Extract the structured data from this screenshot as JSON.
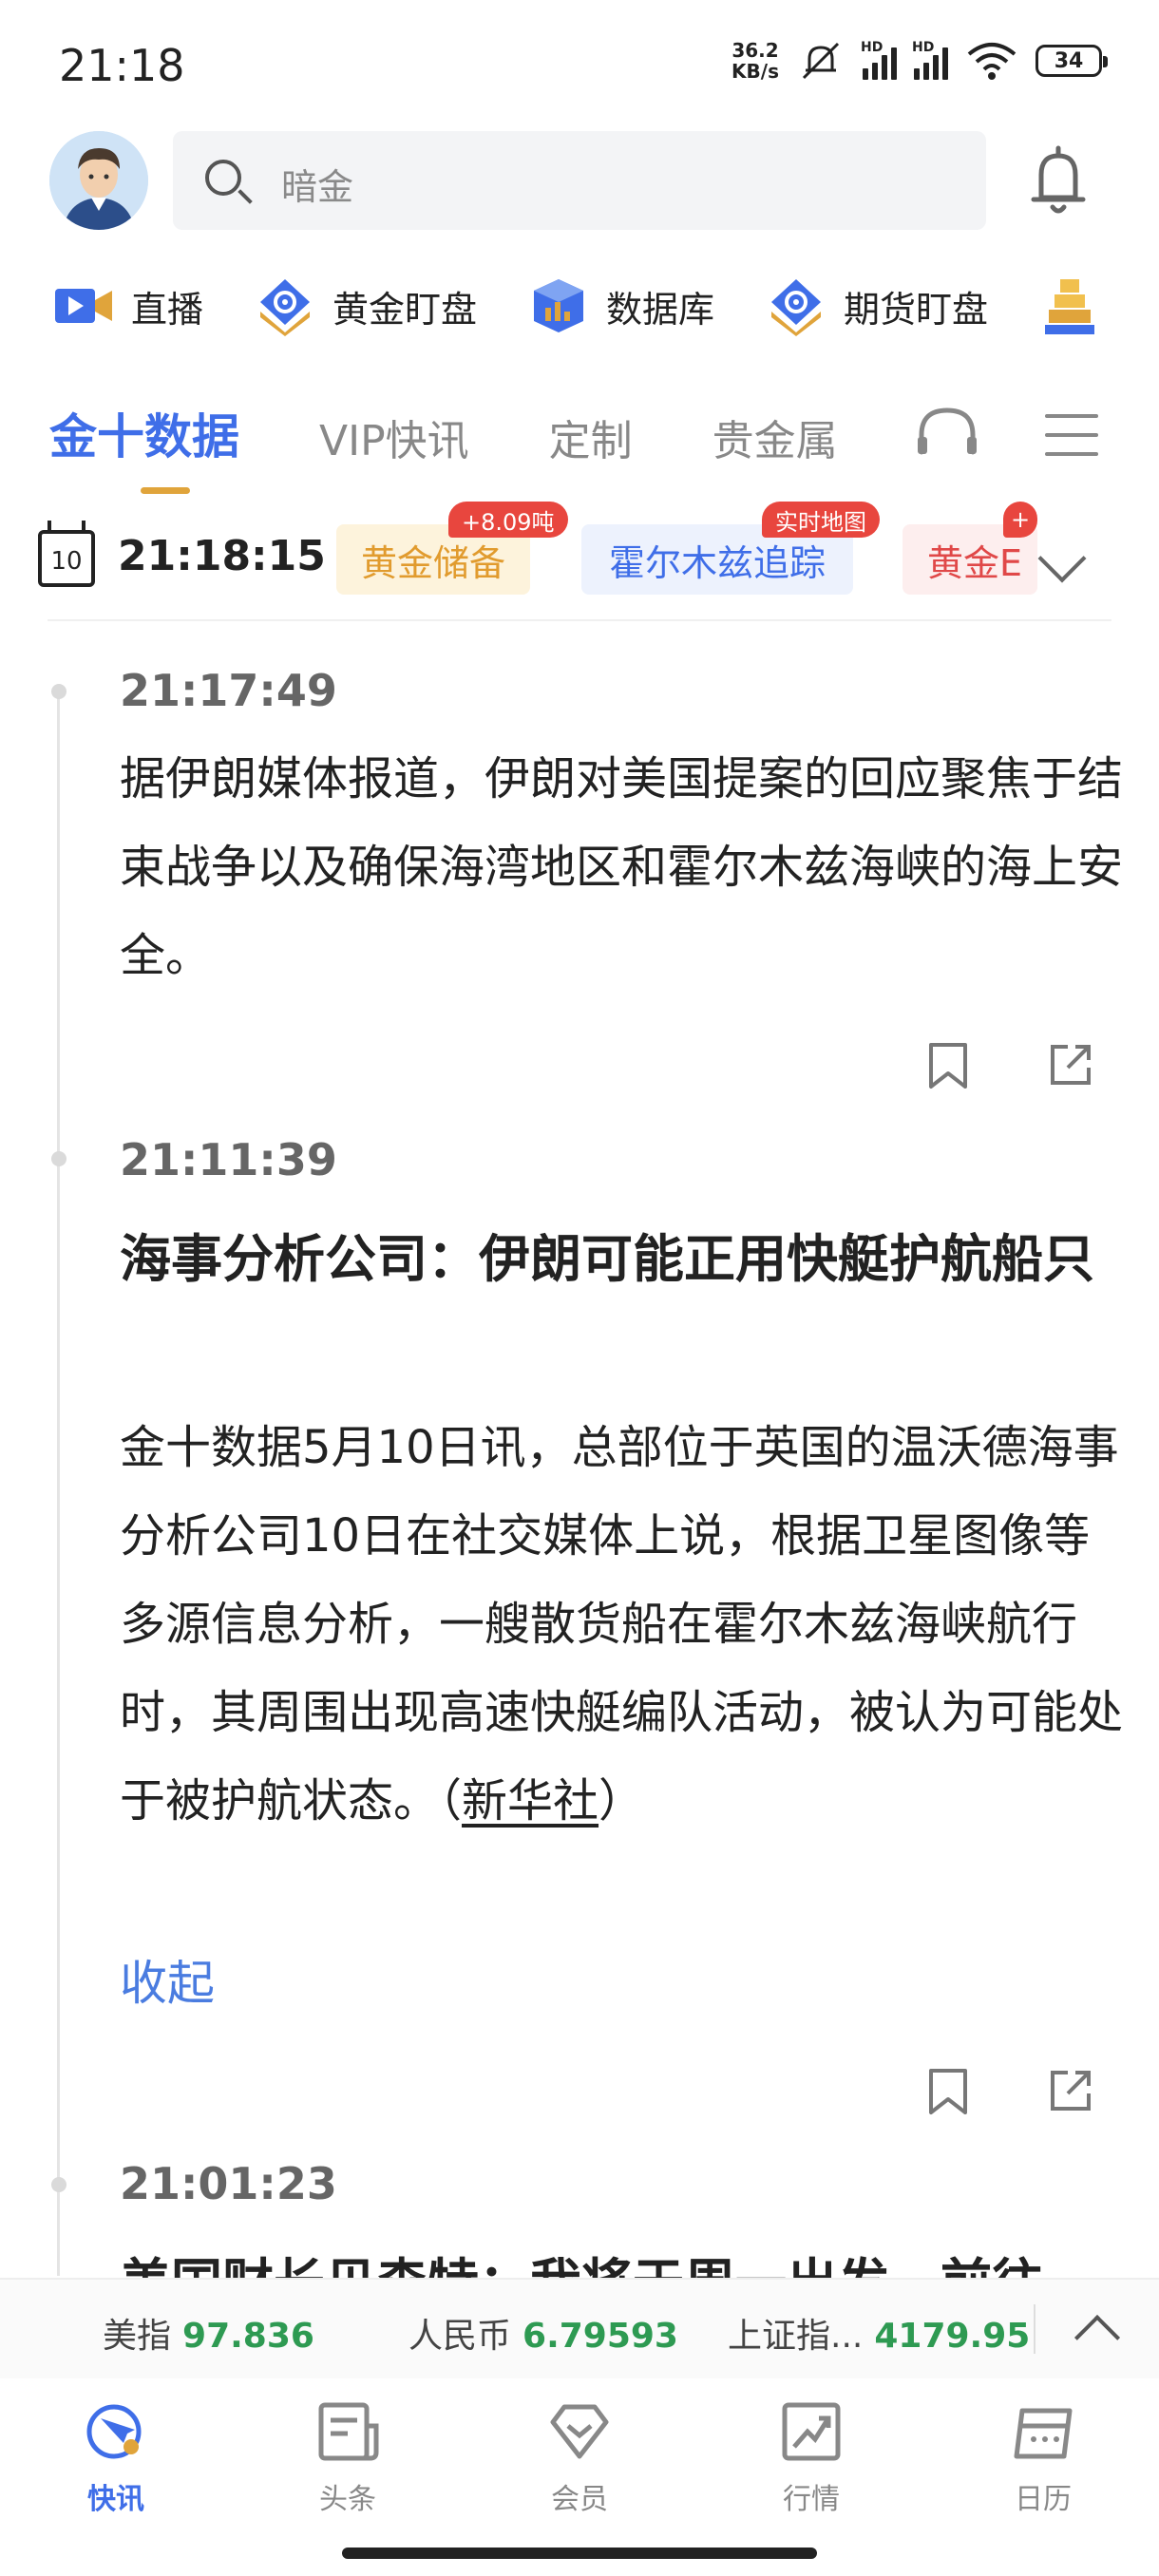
{
  "status_bar": {
    "time": "21:18",
    "net_speed_value": "36.2",
    "net_speed_unit": "KB/s",
    "signal_label": "HD",
    "battery": "34"
  },
  "header": {
    "search_placeholder": "暗金"
  },
  "shortcuts": [
    {
      "label": "直播",
      "icon": "live-video-icon"
    },
    {
      "label": "黄金盯盘",
      "icon": "gold-monitor-icon"
    },
    {
      "label": "数据库",
      "icon": "database-cube-icon"
    },
    {
      "label": "期货盯盘",
      "icon": "futures-monitor-icon"
    },
    {
      "label": "",
      "icon": "gold-bars-icon"
    }
  ],
  "tabs": [
    {
      "label": "金十数据",
      "active": true
    },
    {
      "label": "VIP快讯"
    },
    {
      "label": "定制"
    },
    {
      "label": "贵金属"
    }
  ],
  "ticker": {
    "calendar_day": "10",
    "clock": "21:18:15",
    "chips": [
      {
        "label": "黄金储备",
        "badge": "+8.09吨"
      },
      {
        "label": "霍尔木兹追踪",
        "badge": "实时地图"
      },
      {
        "label": "黄金E",
        "badge": "+"
      }
    ]
  },
  "news": [
    {
      "time": "21:17:49",
      "body": "据伊朗媒体报道，伊朗对美国提案的回应聚焦于结束战争以及确保海湾地区和霍尔木兹海峡的海上安全。"
    },
    {
      "time": "21:11:39",
      "title": "海事分析公司：伊朗可能正用快艇护航船只",
      "body": "金十数据5月10日讯，总部位于英国的温沃德海事分析公司10日在社交媒体上说，根据卫星图像等多源信息分析，一艘散货船在霍尔木兹海峡航行时，其周围出现高速快艇编队活动，被认为可能处于被护航状态。（",
      "source": "新华社",
      "body_end": "）",
      "collapse_label": "收起"
    },
    {
      "time": "21:01:23",
      "title_partial": "美国财长贝森特：我将于周一出发，前往"
    }
  ],
  "market_bar": [
    {
      "name": "美指",
      "value": "97.836"
    },
    {
      "name": "人民币",
      "value": "6.79593"
    },
    {
      "name": "上证指...",
      "value": "4179.95"
    }
  ],
  "bottom_nav": [
    {
      "label": "快讯",
      "active": true
    },
    {
      "label": "头条"
    },
    {
      "label": "会员"
    },
    {
      "label": "行情"
    },
    {
      "label": "日历"
    }
  ],
  "colors": {
    "accent_blue": "#3f6ee8",
    "gold": "#e0a43b",
    "badge_red": "#e8463e",
    "market_green": "#2e9a52"
  }
}
